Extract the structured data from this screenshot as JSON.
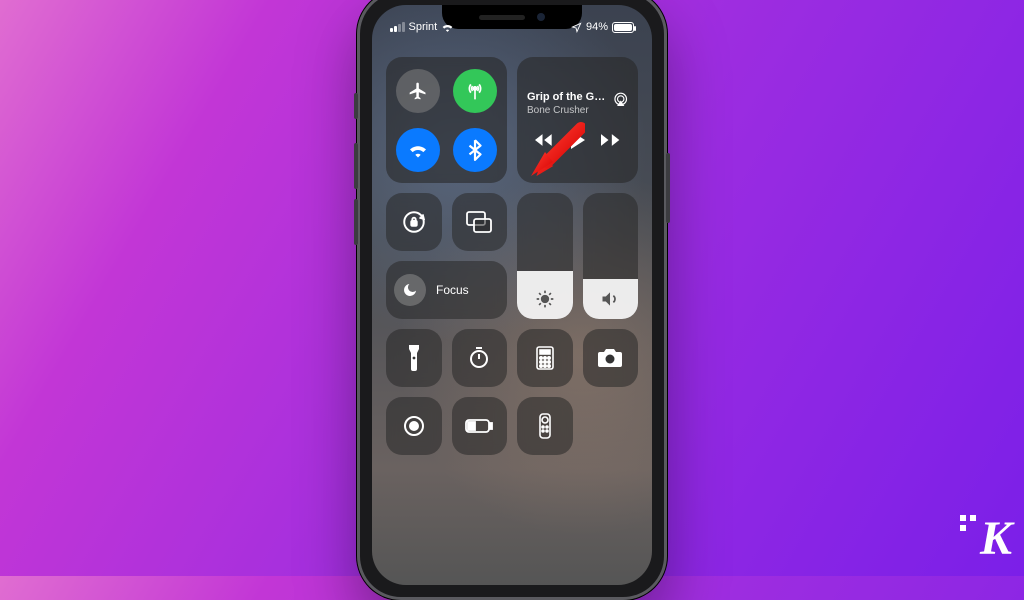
{
  "status": {
    "carrier": "Sprint",
    "battery_percent": "94%"
  },
  "connectivity": {
    "airplane_mode": false,
    "cellular_data": true,
    "wifi": true,
    "bluetooth": true
  },
  "media": {
    "title": "Grip of the Gr…",
    "artist": "Bone Crusher"
  },
  "focus": {
    "label": "Focus"
  },
  "sliders": {
    "brightness_pct": 38,
    "volume_pct": 32
  },
  "shortcuts": [
    "flashlight",
    "timer",
    "calculator",
    "camera",
    "screen-record",
    "low-power",
    "apple-tv-remote"
  ],
  "annotation": {
    "arrow_target": "bluetooth-toggle"
  },
  "watermark": "K"
}
